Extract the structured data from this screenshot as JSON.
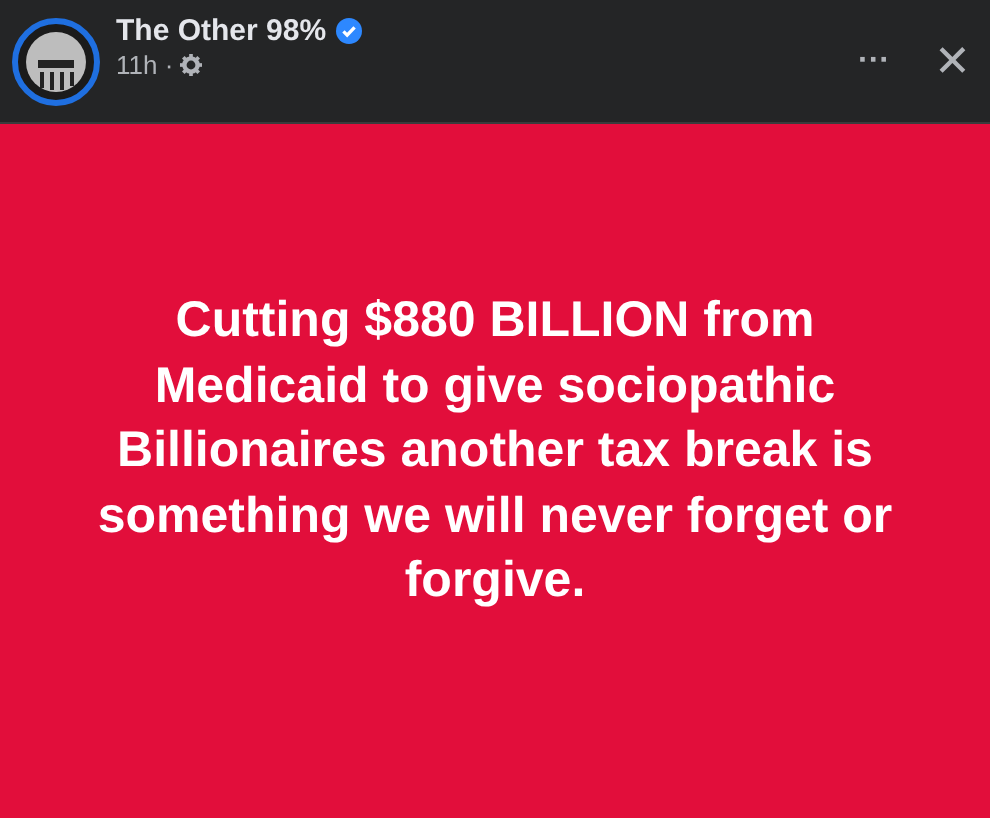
{
  "post": {
    "author": "The Other 98%",
    "verified": true,
    "time": "11h ·",
    "more": "···",
    "close": "✕"
  },
  "card": {
    "text": "Cutting $880 BILLION from Medicaid to give sociopathic Billionaires another tax break is something we will never forget or forgive.",
    "color": "#e20e3b"
  }
}
